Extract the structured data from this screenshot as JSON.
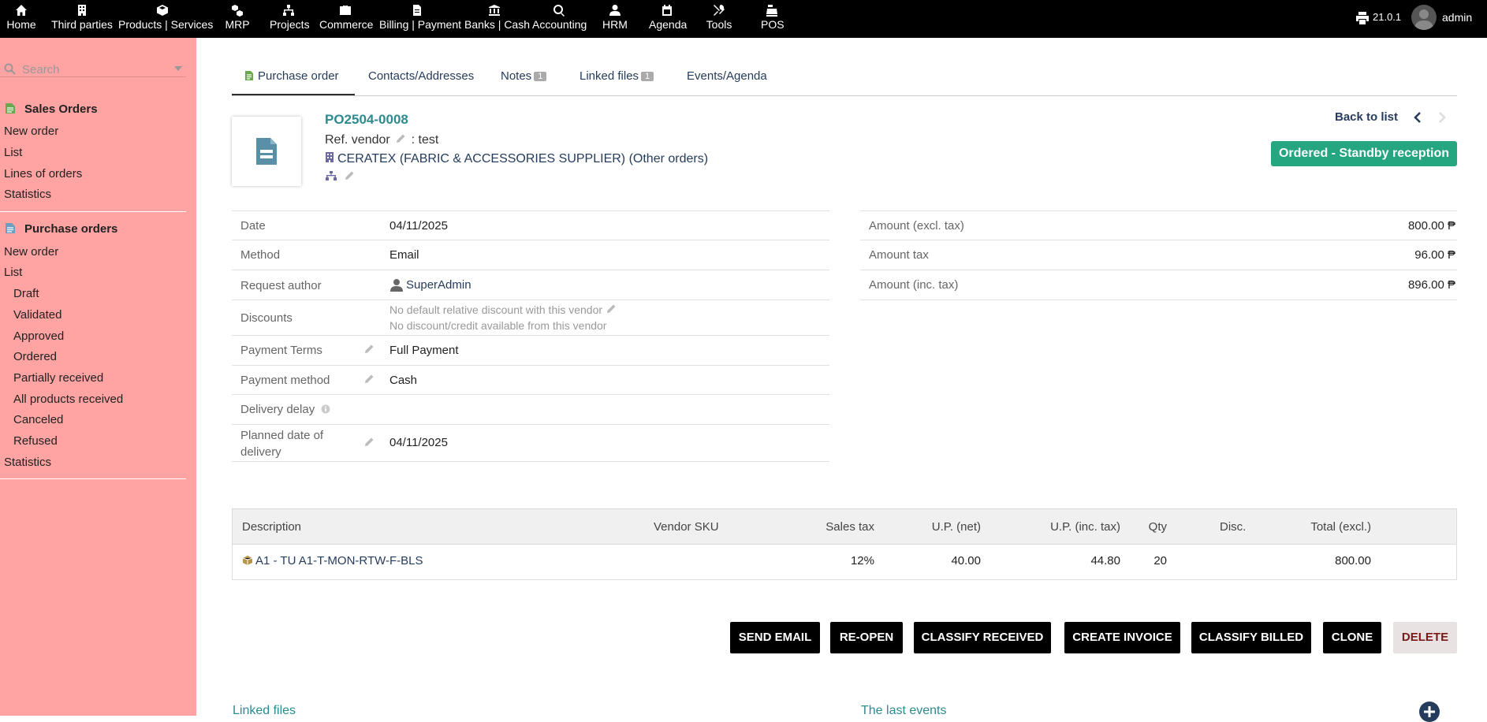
{
  "topmenu": {
    "items": [
      {
        "label": "Home",
        "icon": "home-icon"
      },
      {
        "label": "Third parties",
        "icon": "building-icon"
      },
      {
        "label": "Products | Services",
        "icon": "cube-icon"
      },
      {
        "label": "MRP",
        "icon": "cubes-icon"
      },
      {
        "label": "Projects",
        "icon": "sitemap-icon"
      },
      {
        "label": "Commerce",
        "icon": "briefcase-icon"
      },
      {
        "label": "Billing | Payment",
        "icon": "invoice-icon"
      },
      {
        "label": "Banks | Cash",
        "icon": "bank-icon"
      },
      {
        "label": "Accounting",
        "icon": "search-dollar-icon"
      },
      {
        "label": "HRM",
        "icon": "user-tie-icon"
      },
      {
        "label": "Agenda",
        "icon": "calendar-icon"
      },
      {
        "label": "Tools",
        "icon": "tools-icon"
      },
      {
        "label": "POS",
        "icon": "cash-register-icon"
      }
    ],
    "version": "21.0.1",
    "username": "admin"
  },
  "sidebar": {
    "search_placeholder": "Search",
    "sales": {
      "title": "Sales Orders",
      "items": [
        "New order",
        "List",
        "Lines of orders",
        "Statistics"
      ]
    },
    "purchase": {
      "title": "Purchase orders",
      "items": [
        "New order",
        "List"
      ],
      "sub_items": [
        "Draft",
        "Validated",
        "Approved",
        "Ordered",
        "Partially received",
        "All products received",
        "Canceled",
        "Refused"
      ],
      "stats": "Statistics"
    }
  },
  "tabs": [
    {
      "label": "Purchase order",
      "badge": ""
    },
    {
      "label": "Contacts/Addresses",
      "badge": ""
    },
    {
      "label": "Notes",
      "badge": "1"
    },
    {
      "label": "Linked files",
      "badge": "1"
    },
    {
      "label": "Events/Agenda",
      "badge": ""
    }
  ],
  "header": {
    "ref": "PO2504-0008",
    "ref_vendor_label": "Ref. vendor",
    "ref_vendor_value": ": test",
    "vendor_name": "CERATEX (FABRIC & ACCESSORIES SUPPLIER)",
    "other_orders": "(Other orders)",
    "back_to_list": "Back to list",
    "status": "Ordered - Standby reception"
  },
  "fields": {
    "date_label": "Date",
    "date_value": "04/11/2025",
    "method_label": "Method",
    "method_value": "Email",
    "author_label": "Request author",
    "author_value": "SuperAdmin",
    "discounts_label": "Discounts",
    "discount_line1": "No default relative discount with this vendor",
    "discount_line2": "No discount/credit available from this vendor",
    "terms_label": "Payment Terms",
    "terms_value": "Full Payment",
    "paymethod_label": "Payment method",
    "paymethod_value": "Cash",
    "delay_label": "Delivery delay",
    "planned_label_1": "Planned date of",
    "planned_label_2": "delivery",
    "planned_value": "04/11/2025"
  },
  "amounts": {
    "excl_label": "Amount (excl. tax)",
    "excl_value": "800.00 ₱",
    "tax_label": "Amount tax",
    "tax_value": "96.00 ₱",
    "inc_label": "Amount (inc. tax)",
    "inc_value": "896.00 ₱"
  },
  "lines": {
    "headers": [
      "Description",
      "Vendor SKU",
      "Sales tax",
      "U.P. (net)",
      "U.P. (inc. tax)",
      "Qty",
      "Disc.",
      "Total (excl.)"
    ],
    "rows": [
      {
        "description": "A1 - TU A1-T-MON-RTW-F-BLS",
        "sku": "",
        "tax": "12%",
        "up_net": "40.00",
        "up_inc": "44.80",
        "qty": "20",
        "disc": "",
        "total": "800.00"
      }
    ]
  },
  "actions": [
    "SEND EMAIL",
    "RE-OPEN",
    "CLASSIFY RECEIVED",
    "CREATE INVOICE",
    "CLASSIFY BILLED",
    "CLONE",
    "DELETE"
  ],
  "bottom": {
    "linked_files": "Linked files",
    "last_events": "The last events"
  }
}
